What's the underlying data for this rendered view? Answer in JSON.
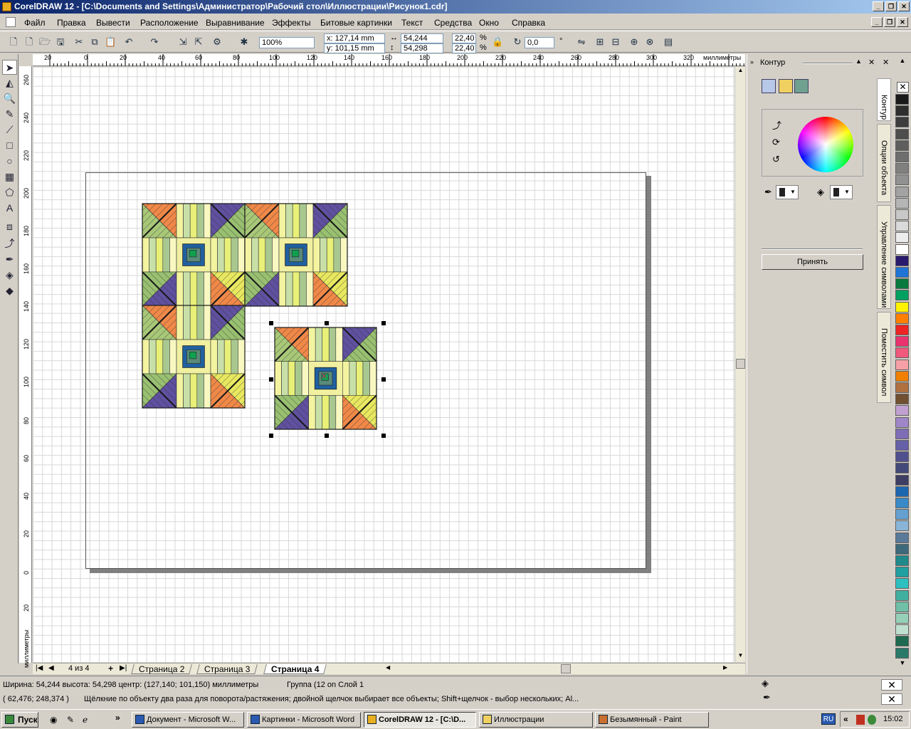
{
  "window": {
    "title": "CorelDRAW 12 - [C:\\Documents and Settings\\Администратор\\Рабочий стол\\Иллюстрации\\Рисунок1.cdr]",
    "min": "_",
    "max": "❐",
    "close": "✕"
  },
  "menu": [
    "Файл",
    "Правка",
    "Вывести",
    "Расположение",
    "Выравнивание",
    "Эффекты",
    "Битовые картинки",
    "Текст",
    "Средства",
    "Окно",
    "Справка"
  ],
  "toolbar": {
    "zoom": "100%",
    "x": "x: 127,14 mm",
    "y": "y: 101,15 mm",
    "w": "54,244 mm",
    "h": "54,298 mm",
    "sx": "22,40",
    "sy": "22,40",
    "pct1": "%",
    "pct2": "%",
    "angle": "0,0",
    "deg": "°"
  },
  "hruler": {
    "ticks": [
      "20",
      "0",
      "20",
      "40",
      "60",
      "80",
      "100",
      "120",
      "140",
      "160",
      "180",
      "200",
      "220",
      "240",
      "260",
      "280",
      "300",
      "320"
    ],
    "unit": "миллиметры"
  },
  "vruler": {
    "ticks": [
      "260",
      "240",
      "220",
      "200",
      "180",
      "160",
      "140",
      "120",
      "100",
      "80",
      "60",
      "40",
      "20",
      "0",
      "20"
    ],
    "unit": "миллиметры"
  },
  "tabs": {
    "counter": "4 из 4",
    "plus": "+",
    "pages": [
      "Страница 2",
      "Страница 3",
      "Страница 4"
    ]
  },
  "docker": {
    "title": "Контур",
    "apply": "Принять",
    "vtabs": [
      "Контур",
      "Опции объекта",
      "Управление символами",
      "Поместить символ"
    ]
  },
  "status": {
    "line1_left": "Ширина: 54,244  высота: 54,298  центр: (127,140; 101,150)  миллиметры",
    "line1_right": "Группа (12 on Слой 1",
    "line2_left": "( 62,476; 248,374 )",
    "line2_right": "Щёлкние по объекту два раза для поворота/растяжения; двойной щелчок выбирает все объекты; Shift+щелчок - выбор нескольких; Al..."
  },
  "taskbar": {
    "start": "Пуск",
    "items": [
      "Документ - Microsoft W...",
      "Картинки - Microsoft Word",
      "CorelDRAW 12 - [C:\\D...",
      "Иллюстрации",
      "Безымянный - Paint"
    ],
    "lang": "RU",
    "time": "15:02",
    "chevron": "»",
    "tray_chev": "«"
  },
  "colors": {
    "palette": [
      "#1a1a1a",
      "#2e2e2e",
      "#3d3d3d",
      "#4d4d4d",
      "#5e5e5e",
      "#6e6e6e",
      "#808080",
      "#919191",
      "#a3a3a3",
      "#b5b5b5",
      "#c8c8c8",
      "#dadada",
      "#ededed",
      "#ffffff",
      "#2a1a6e",
      "#1f75d6",
      "#0a7a3e",
      "#00a060",
      "#fff200",
      "#ff7f00",
      "#ee2424",
      "#e8336e",
      "#f0587c",
      "#f6a0a6",
      "#f08000",
      "#b07040",
      "#705030",
      "#c0a0d0",
      "#9f86c8",
      "#7e6db6",
      "#6660a8",
      "#51508f",
      "#434a7a",
      "#3e3e64",
      "#1d66b0",
      "#3a8ac8",
      "#64a0d0",
      "#8ab5d8",
      "#5a7a9a",
      "#3c6a7a",
      "#208a8a",
      "#20a0a0",
      "#2cc0c0",
      "#40b0a0",
      "#70c0a8",
      "#96d0b8",
      "#bfe0d0",
      "#1e6a50",
      "#2a7a6a"
    ]
  }
}
